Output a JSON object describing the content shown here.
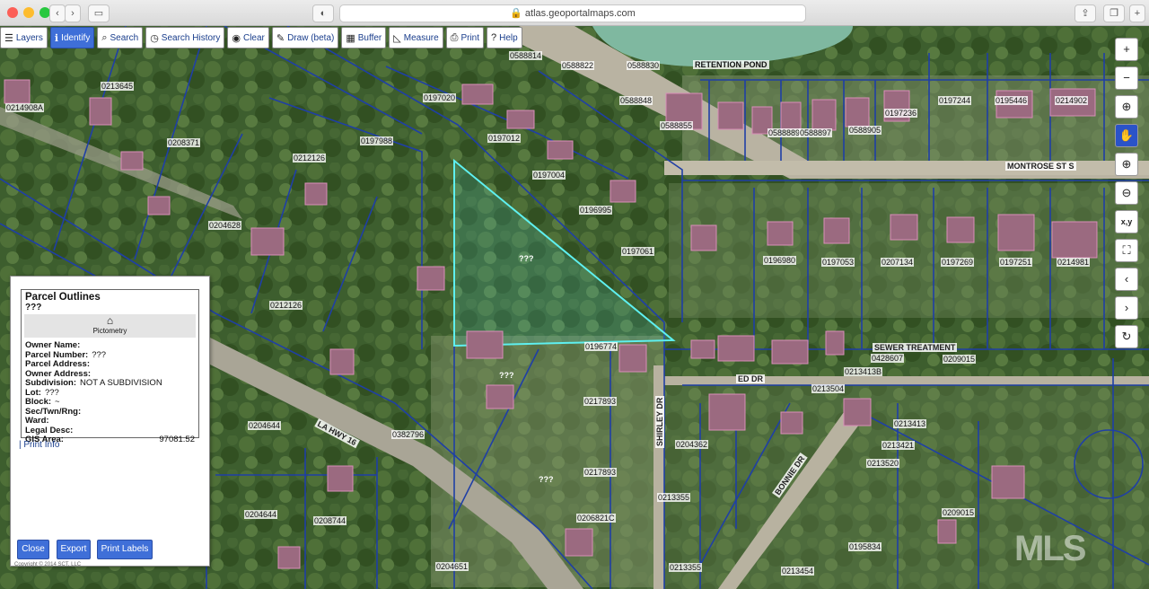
{
  "browser": {
    "url": "atlas.geoportalmaps.com"
  },
  "toolbar": {
    "layers": "Layers",
    "identify": "Identify",
    "search": "Search",
    "history": "Search History",
    "clear": "Clear",
    "draw": "Draw (beta)",
    "buffer": "Buffer",
    "measure": "Measure",
    "print": "Print",
    "help": "Help"
  },
  "map_labels": {
    "retention_pond": "RETENTION POND",
    "montrose": "MONTROSE ST S",
    "sewer": "SEWER TREATMENT",
    "ed_dr": "ED DR",
    "la_hwy": "LA HWY 16",
    "shirley": "SHIRLEY DR",
    "bonnie": "BONNIE DR",
    "unknown": "???",
    "watermark": "MLS"
  },
  "parcel_numbers": [
    {
      "t": "0588814",
      "c": "#111"
    },
    {
      "t": "0588822",
      "c": "#111"
    },
    {
      "t": "0588830",
      "c": "#111"
    },
    {
      "t": "0588848",
      "c": "#111"
    },
    {
      "t": "0588855",
      "c": "#111"
    },
    {
      "t": "0588905",
      "c": "#111"
    },
    {
      "t": "0197236",
      "c": "#111"
    },
    {
      "t": "0197244",
      "c": "#111"
    },
    {
      "t": "0195446",
      "c": "#111"
    },
    {
      "t": "0214902",
      "c": "#111"
    },
    {
      "t": "0197020",
      "c": "#111"
    },
    {
      "t": "0197012",
      "c": "#111"
    },
    {
      "t": "0197004",
      "c": "#111"
    },
    {
      "t": "0197988",
      "c": "#111"
    },
    {
      "t": "0212126",
      "c": "#111"
    },
    {
      "t": "0204628",
      "c": "#111"
    },
    {
      "t": "0214908A",
      "c": "#111"
    },
    {
      "t": "0208371",
      "c": "#111"
    },
    {
      "t": "0213645",
      "c": "#111"
    },
    {
      "t": "0196995",
      "c": "#111"
    },
    {
      "t": "0197061",
      "c": "#111"
    },
    {
      "t": "0196980",
      "c": "#111"
    },
    {
      "t": "0197053",
      "c": "#111"
    },
    {
      "t": "0207134",
      "c": "#111"
    },
    {
      "t": "0197269",
      "c": "#111"
    },
    {
      "t": "0197251",
      "c": "#111"
    },
    {
      "t": "0214981",
      "c": "#111"
    },
    {
      "t": "0212126",
      "c": "#111"
    },
    {
      "t": "0196774",
      "c": "#111"
    },
    {
      "t": "0428607",
      "c": "#111"
    },
    {
      "t": "0209015",
      "c": "#111"
    },
    {
      "t": "0217893",
      "c": "#111"
    },
    {
      "t": "0213413B",
      "c": "#111"
    },
    {
      "t": "0213413",
      "c": "#111"
    },
    {
      "t": "0213421",
      "c": "#111"
    },
    {
      "t": "0213520",
      "c": "#111"
    },
    {
      "t": "0204644",
      "c": "#111"
    },
    {
      "t": "0382796",
      "c": "#111"
    },
    {
      "t": "0204362",
      "c": "#111"
    },
    {
      "t": "0213355",
      "c": "#111"
    },
    {
      "t": "0206821C",
      "c": "#111"
    },
    {
      "t": "0217893",
      "c": "#111"
    },
    {
      "t": "0204644",
      "c": "#111"
    },
    {
      "t": "0208744",
      "c": "#111"
    },
    {
      "t": "0209015",
      "c": "#111"
    },
    {
      "t": "0195834",
      "c": "#111"
    },
    {
      "t": "0204651",
      "c": "#111"
    },
    {
      "t": "0213355",
      "c": "#111"
    },
    {
      "t": "0213454",
      "c": "#111"
    },
    {
      "t": "0213504",
      "c": "#111"
    },
    {
      "t": "0588889",
      "c": "#111"
    },
    {
      "t": "0588897",
      "c": "#111"
    }
  ],
  "popup": {
    "title": "Parcel Outlines",
    "subtitle": "???",
    "pictometry": "Pictometry",
    "rows": [
      {
        "k": "Owner Name:",
        "v": ""
      },
      {
        "k": "Parcel Number:",
        "v": "???"
      },
      {
        "k": "Parcel Address:",
        "v": ""
      },
      {
        "k": "Owner Address:",
        "v": ""
      },
      {
        "k": "Subdivision:",
        "v": "NOT A SUBDIVISION"
      },
      {
        "k": "Lot:",
        "v": "???"
      },
      {
        "k": "Block:",
        "v": "~"
      },
      {
        "k": "Sec/Twn/Rng:",
        "v": ""
      },
      {
        "k": "Ward:",
        "v": ""
      },
      {
        "k": "Legal Desc:",
        "v": ""
      },
      {
        "k": "GIS Area:",
        "v": "97081.52"
      }
    ],
    "print_info": "Print Info",
    "close": "Close",
    "export": "Export",
    "print_labels": "Print Labels",
    "copyright": "Copyright © 2014 SCT, LLC"
  }
}
